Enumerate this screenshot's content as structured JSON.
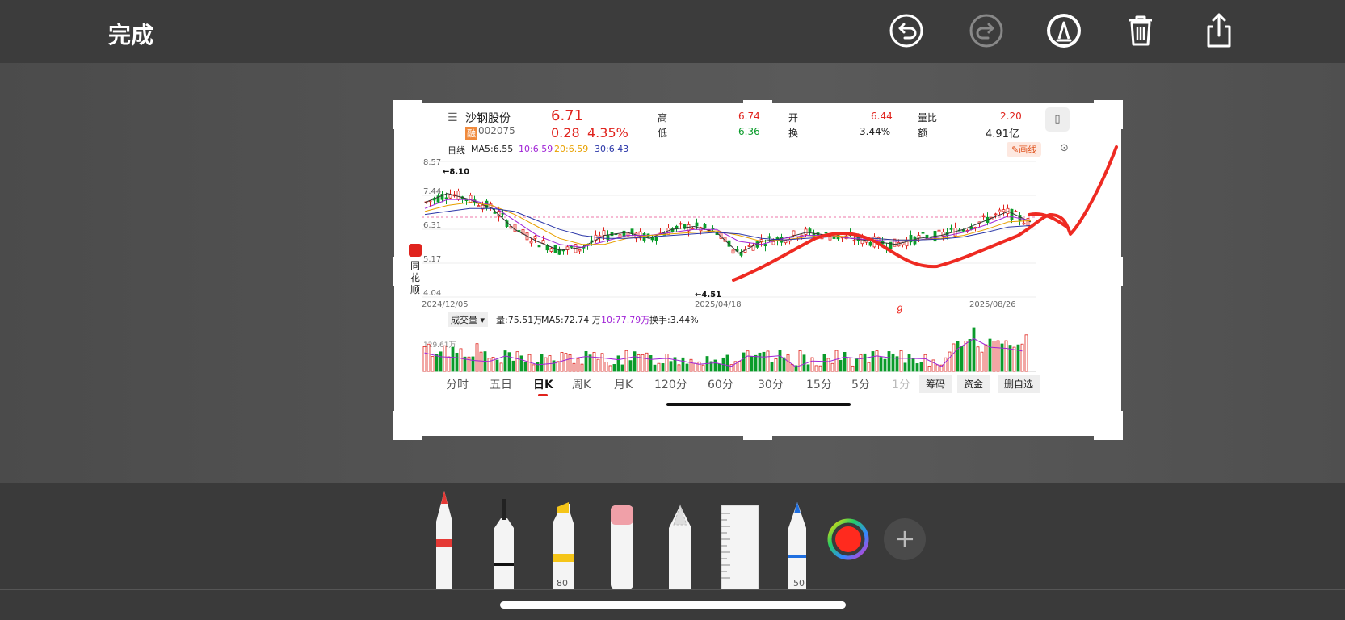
{
  "toolbar": {
    "done_label": "完成",
    "icons": [
      "undo-icon",
      "redo-icon",
      "markup-pen-icon",
      "trash-icon",
      "share-icon"
    ]
  },
  "stock": {
    "name": "沙钢股份",
    "badge": "融",
    "code": "002075",
    "price": "6.71",
    "change": "0.28",
    "change_pct": "4.35%",
    "high_label": "高",
    "high": "6.74",
    "low_label": "低",
    "low": "6.36",
    "open_label": "开",
    "open": "6.44",
    "turnover_label": "换",
    "turnover": "3.44%",
    "ratio_label": "量比",
    "ratio": "2.20",
    "amount_label": "额",
    "amount": "4.91亿",
    "side_brand": "同花顺"
  },
  "kline": {
    "period_label": "日线",
    "ma5": "MA5:6.55",
    "ma10": "10:6.59",
    "ma20": "20:6.59",
    "ma30": "30:6.43",
    "draw_line_label": "画线",
    "y_ticks": [
      "8.57",
      "7.44",
      "6.31",
      "5.17",
      "4.04"
    ],
    "high_marker": "←8.10",
    "low_marker": "←4.51",
    "x_dates": [
      "2024/12/05",
      "2025/04/18",
      "2025/08/26"
    ]
  },
  "volume": {
    "selector": "成交量",
    "vol": "量:75.51万",
    "ma5": "MA5:72.74 万",
    "ma10": "10:77.79万",
    "turnover": "换手:3.44%",
    "max_tick": "129.61万"
  },
  "period_tabs": [
    "分时",
    "五日",
    "日K",
    "周K",
    "月K",
    "120分",
    "60分",
    "30分",
    "15分",
    "5分",
    "1分"
  ],
  "active_tab": "日K",
  "right_buttons": [
    "筹码",
    "资金",
    "删自选"
  ],
  "tools": {
    "marker_number": "80",
    "pencil_number": "50"
  },
  "colors": {
    "red": "#e0231d",
    "green": "#0a9b2a",
    "ink": "#ee2a22"
  },
  "chart_data": {
    "type": "line",
    "title": "",
    "series": [
      {
        "name": "MA5",
        "values": [
          7.2,
          7.5,
          7.3,
          7.0,
          6.3,
          5.9,
          5.6,
          5.7,
          6.1,
          6.2,
          6.0,
          6.3,
          6.4,
          6.2,
          5.5,
          5.9,
          6.0,
          6.2,
          6.1,
          6.0,
          5.9,
          5.8,
          6.0,
          6.1,
          6.3,
          6.6,
          6.9,
          6.55
        ]
      },
      {
        "name": "MA10",
        "values": [
          7.0,
          7.3,
          7.3,
          7.1,
          6.6,
          6.1,
          5.8,
          5.7,
          5.9,
          6.1,
          6.1,
          6.2,
          6.3,
          6.3,
          5.9,
          5.8,
          6.0,
          6.1,
          6.1,
          6.0,
          5.95,
          5.9,
          5.95,
          6.05,
          6.2,
          6.45,
          6.75,
          6.59
        ]
      },
      {
        "name": "MA20",
        "values": [
          6.9,
          7.1,
          7.2,
          7.1,
          6.8,
          6.4,
          6.0,
          5.8,
          5.8,
          6.0,
          6.1,
          6.15,
          6.2,
          6.25,
          6.1,
          5.9,
          5.95,
          6.05,
          6.1,
          6.05,
          6.0,
          5.95,
          5.95,
          6.0,
          6.1,
          6.3,
          6.55,
          6.59
        ]
      },
      {
        "name": "MA30",
        "values": [
          6.8,
          6.9,
          7.0,
          7.0,
          6.9,
          6.6,
          6.3,
          6.1,
          6.0,
          6.0,
          6.05,
          6.1,
          6.15,
          6.2,
          6.15,
          6.0,
          5.95,
          6.0,
          6.05,
          6.05,
          6.0,
          5.95,
          5.95,
          5.98,
          6.05,
          6.2,
          6.38,
          6.43
        ]
      }
    ],
    "ylim": [
      4.04,
      8.57
    ],
    "xlabel": "",
    "ylabel": ""
  }
}
